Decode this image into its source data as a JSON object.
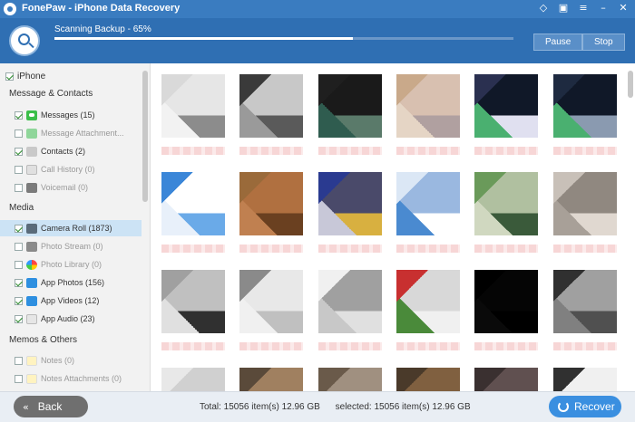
{
  "window": {
    "title": "FonePaw - iPhone Data Recovery",
    "controls": [
      "diamond-icon",
      "gift-icon",
      "menu-icon",
      "minimize-icon",
      "close-icon"
    ]
  },
  "scan": {
    "status": "Scanning Backup - 65%",
    "progress": 0.65,
    "pause_label": "Pause",
    "stop_label": "Stop"
  },
  "sidebar": {
    "root": "iPhone",
    "sections": [
      {
        "title": "Message & Contacts",
        "items": [
          {
            "label": "Messages (15)",
            "checked": true,
            "dim": false
          },
          {
            "label": "Message Attachment...",
            "checked": false,
            "dim": true
          },
          {
            "label": "Contacts (2)",
            "checked": true,
            "dim": false
          },
          {
            "label": "Call History (0)",
            "checked": false,
            "dim": true
          },
          {
            "label": "Voicemail (0)",
            "checked": false,
            "dim": true
          }
        ]
      },
      {
        "title": "Media",
        "items": [
          {
            "label": "Camera Roll (1873)",
            "checked": true,
            "dim": false,
            "selected": true
          },
          {
            "label": "Photo Stream (0)",
            "checked": false,
            "dim": true
          },
          {
            "label": "Photo Library (0)",
            "checked": false,
            "dim": true
          },
          {
            "label": "App Photos (156)",
            "checked": true,
            "dim": false
          },
          {
            "label": "App Videos (12)",
            "checked": true,
            "dim": false
          },
          {
            "label": "App Audio (23)",
            "checked": true,
            "dim": false
          }
        ]
      },
      {
        "title": "Memos & Others",
        "items": [
          {
            "label": "Notes (0)",
            "checked": false,
            "dim": true
          },
          {
            "label": "Notes Attachments (0)",
            "checked": false,
            "dim": true
          }
        ]
      }
    ]
  },
  "thumbnails": [
    {
      "colors": [
        "#d9d9d9",
        "#f2f2f2",
        "#8c8c8c",
        "#e6e6e6"
      ]
    },
    {
      "colors": [
        "#3a3a3a",
        "#9a9a9a",
        "#5a5a5a",
        "#c8c8c8"
      ]
    },
    {
      "colors": [
        "#1f1f1f",
        "#2f5c4f",
        "#5a7a6a",
        "#1a1a1a"
      ]
    },
    {
      "colors": [
        "#c9a98a",
        "#e5d5c5",
        "#b0a0a0",
        "#d8c0b0"
      ]
    },
    {
      "colors": [
        "#2a3050",
        "#4ab070",
        "#e0e0f0",
        "#101828"
      ]
    },
    {
      "colors": [
        "#1e2a40",
        "#4ab070",
        "#8a9ab0",
        "#101828"
      ]
    },
    {
      "colors": [
        "#3a86d8",
        "#e8f0fa",
        "#6aaae8",
        "#ffffff"
      ]
    },
    {
      "colors": [
        "#9a6a3a",
        "#c08050",
        "#6a4020",
        "#b07040"
      ]
    },
    {
      "colors": [
        "#2a3a90",
        "#c8c8d8",
        "#d8b040",
        "#4a4a6a"
      ]
    },
    {
      "colors": [
        "#dbe7f5",
        "#4a8ad0",
        "#ffffff",
        "#9ab8e0"
      ]
    },
    {
      "colors": [
        "#6a9a5a",
        "#d0d8c0",
        "#3a5a3a",
        "#b0c0a0"
      ]
    },
    {
      "colors": [
        "#c8c0b8",
        "#a8a098",
        "#e0d8d0",
        "#908880"
      ]
    },
    {
      "colors": [
        "#a0a0a0",
        "#e0e0e0",
        "#303030",
        "#c0c0c0"
      ]
    },
    {
      "colors": [
        "#8a8a8a",
        "#f0f0f0",
        "#c0c0c0",
        "#e8e8e8"
      ]
    },
    {
      "colors": [
        "#f0f0f0",
        "#c8c8c8",
        "#e0e0e0",
        "#a0a0a0"
      ]
    },
    {
      "colors": [
        "#c83030",
        "#4a8a3a",
        "#f0f0f0",
        "#d8d8d8"
      ]
    },
    {
      "colors": [
        "#000000",
        "#0a0a0a",
        "#000000",
        "#050505"
      ]
    },
    {
      "colors": [
        "#303030",
        "#808080",
        "#505050",
        "#a0a0a0"
      ]
    },
    {
      "colors": [
        "#e8e8e8",
        "#c0c0c0",
        "#f5f5f5",
        "#d0d0d0"
      ]
    },
    {
      "colors": [
        "#5a4a3a",
        "#c0a080",
        "#3a3a3a",
        "#a08060"
      ]
    },
    {
      "colors": [
        "#6a5a4a",
        "#d0c0b0",
        "#303030",
        "#a09080"
      ]
    },
    {
      "colors": [
        "#4a3a2a",
        "#b09070",
        "#202020",
        "#806040"
      ]
    },
    {
      "colors": [
        "#3a3030",
        "#c0b0a0",
        "#a09080",
        "#605050"
      ]
    },
    {
      "colors": [
        "#303030",
        "#d0d0d0",
        "#606060",
        "#f0f0f0"
      ]
    }
  ],
  "footer": {
    "back_label": "Back",
    "total": "Total: 15056 item(s) 12.96 GB",
    "selected": "selected: 15056 item(s) 12.96 GB",
    "recover_label": "Recover"
  },
  "colors": {
    "titlebar": "#3a7cc0",
    "header": "#2f6fb3",
    "selection": "#cce3f5",
    "recover": "#3a8fe0"
  }
}
